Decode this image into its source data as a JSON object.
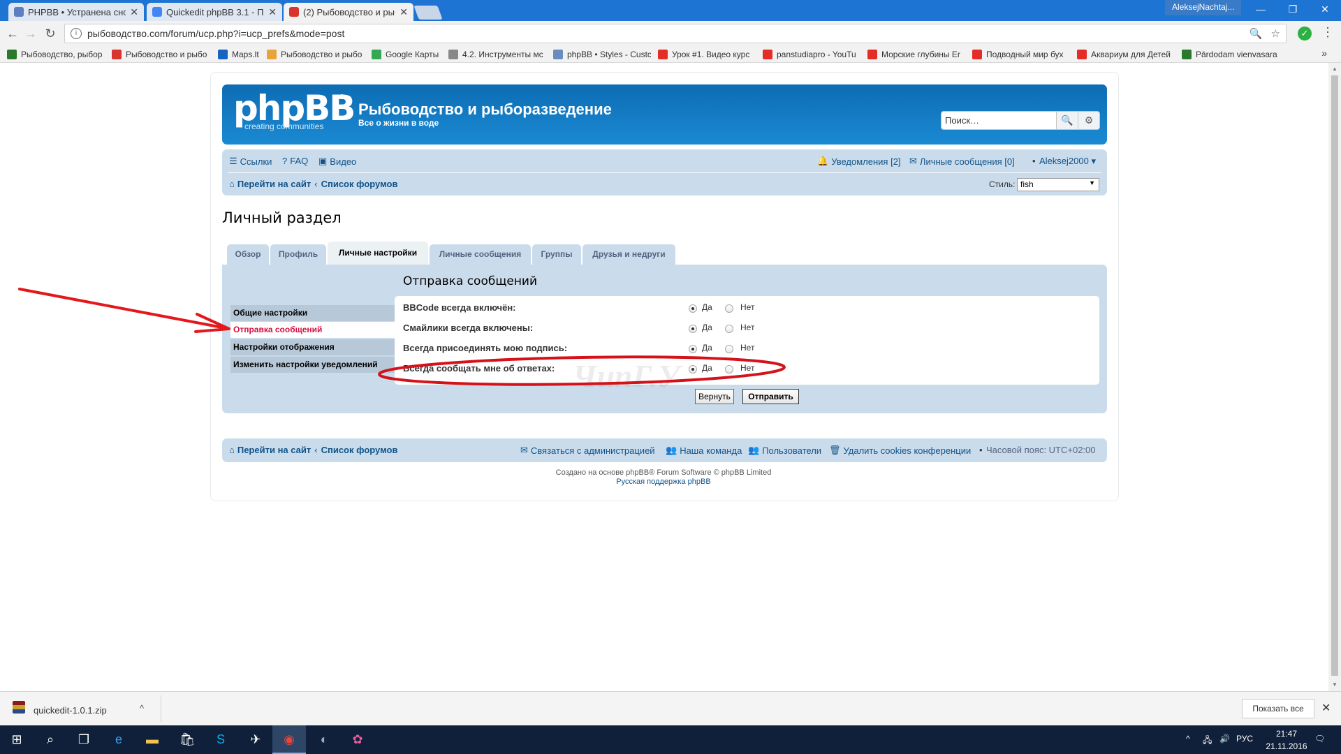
{
  "browser": {
    "tabs": [
      {
        "title": "PHPBB • Устранена сноc",
        "color": "#5b7fbf"
      },
      {
        "title": "Quickedit phpBB 3.1 - П",
        "color": "#4285f4"
      },
      {
        "title": "(2) Рыбоводство и рыбо",
        "color": "#d9352d"
      }
    ],
    "user_badge": "AleksejNachtaj...",
    "window_controls": {
      "minimize": "—",
      "restore": "❐",
      "close": "✕"
    },
    "nav": {
      "back": "←",
      "forward": "→",
      "reload": "↻"
    },
    "url": "рыбоводство.com/forum/ucp.php?i=ucp_prefs&mode=post",
    "url_info": "i",
    "zoom_icon": "🔍",
    "star_icon": "☆",
    "ext_icon": "✓",
    "menu_icon": "⋮",
    "bookmarks": [
      {
        "label": "Рыбоводство, рыбор",
        "color": "#2b7a2b"
      },
      {
        "label": "Рыбоводство и рыбо",
        "color": "#d9352d"
      },
      {
        "label": "Maps.lt",
        "color": "#1565c0"
      },
      {
        "label": "Рыбоводство и рыбо",
        "color": "#e8a33a"
      },
      {
        "label": "Google Карты",
        "color": "#34a853"
      },
      {
        "label": "4.2. Инструменты мс",
        "color": "#888"
      },
      {
        "label": "phpBB • Styles - Custc",
        "color": "#6a8cbf"
      },
      {
        "label": "Урок #1. Видео курс",
        "color": "#e52d27"
      },
      {
        "label": "panstudiapro - YouTu",
        "color": "#e52d27"
      },
      {
        "label": "Морские глубины Er",
        "color": "#e52d27"
      },
      {
        "label": "Подводный мир бух",
        "color": "#e52d27"
      },
      {
        "label": "Аквариум для Детей",
        "color": "#e52d27"
      },
      {
        "label": "Pārdodam vienvasara",
        "color": "#2b7a2b"
      }
    ],
    "bookmarks_more": "»"
  },
  "forum": {
    "logo_text": "phpBB",
    "logo_tagline": "creating communities",
    "logo_reg": "®",
    "site_title": "Рыбоводство и рыборазведение",
    "site_desc": "Все о жизни в воде",
    "search_placeholder": "Поиск…",
    "search_icon": "🔍",
    "adv_search_icon": "⚙",
    "nav_links": {
      "links": "Ссылки",
      "faq": "FAQ",
      "video": "Видео"
    },
    "notifications": "Уведомления [2]",
    "private_messages": "Личные сообщения [0]",
    "username": "Aleksej2000 ▾",
    "breadcrumb": {
      "site": "Перейти на сайт",
      "sep": "‹",
      "index": "Список форумов"
    },
    "style_label": "Стиль:",
    "style_value": "fish",
    "page_title": "Личный раздел",
    "tabs": [
      "Обзор",
      "Профиль",
      "Личные настройки",
      "Личные сообщения",
      "Группы",
      "Друзья и недруги"
    ],
    "sidenav": [
      "Общие настройки",
      "Отправка сообщений",
      "Настройки отображения",
      "Изменить настройки уведомлений"
    ],
    "section_title": "Отправка сообщений",
    "options": [
      {
        "label": "BBCode всегда включён:",
        "yes": "Да",
        "no": "Нет",
        "value": "yes"
      },
      {
        "label": "Смайлики всегда включены:",
        "yes": "Да",
        "no": "Нет",
        "value": "yes"
      },
      {
        "label": "Всегда присоединять мою подпись:",
        "yes": "Да",
        "no": "Нет",
        "value": "yes"
      },
      {
        "label": "Всегда сообщать мне об ответах:",
        "yes": "Да",
        "no": "Нет",
        "value": "yes"
      }
    ],
    "buttons": {
      "reset": "Вернуть",
      "submit": "Отправить"
    },
    "footer": {
      "contact": "Связаться с администрацией",
      "team": "Наша команда",
      "members": "Пользователи",
      "delete_cookies": "Удалить cookies конференции",
      "timezone": "Часовой пояс: UTC+02:00"
    },
    "credit": "Создано на основе phpBB® Forum Software © phpBB Limited",
    "credit_link": "Русская поддержка phpBB",
    "watermark": "ЧипГ.У"
  },
  "downloads": {
    "file": "quickedit-1.0.1.zip",
    "caret": "^",
    "show_all": "Показать все",
    "close": "✕"
  },
  "taskbar": {
    "items": [
      "start-icon",
      "search-icon",
      "task-view-icon",
      "edge-icon",
      "explorer-icon",
      "store-icon",
      "skype-icon",
      "app-icon",
      "chrome-icon",
      "app2-icon",
      "paint-icon"
    ],
    "lang": "РУС",
    "time": "21:47",
    "date": "21.11.2016"
  }
}
